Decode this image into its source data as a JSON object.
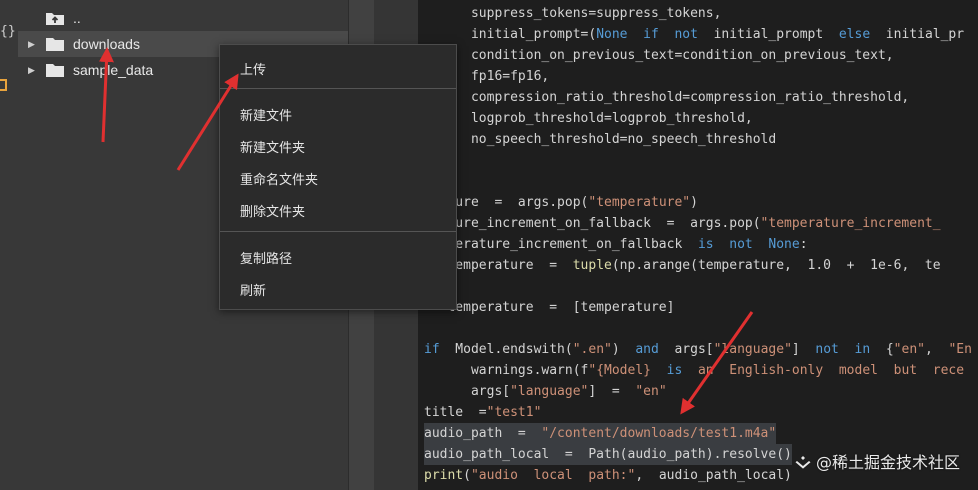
{
  "left_strip": {
    "brace": "{}"
  },
  "file_browser": {
    "items": [
      {
        "label": "..",
        "type": "parent"
      },
      {
        "label": "downloads",
        "type": "folder"
      },
      {
        "label": "sample_data",
        "type": "folder"
      }
    ]
  },
  "context_menu": {
    "items": [
      "上传",
      "新建文件",
      "新建文件夹",
      "重命名文件夹",
      "删除文件夹",
      "复制路径",
      "刷新"
    ]
  },
  "code_lines": [
    "      suppress_tokens=suppress_tokens,",
    "      initial_prompt=(None  if  not  initial_prompt  else  initial_pr",
    "      condition_on_previous_text=condition_on_previous_text,",
    "      fp16=fp16,",
    "      compression_ratio_threshold=compression_ratio_threshold,",
    "      logprob_threshold=logprob_threshold,",
    "      no_speech_threshold=no_speech_threshold",
    "",
    "",
    "erature  =  args.pop(\"temperature\")",
    "erature_increment_on_fallback  =  args.pop(\"temperature_increment_",
    "temperature_increment_on_fallback  is  not  None:",
    "   temperature  =  tuple(np.arange(temperature,  1.0  +  1e-6,  te",
    ":",
    "   temperature  =  [temperature]",
    "",
    "if  Model.endswith(\".en\")  and  args[\"language\"]  not  in  {\"en\",  \"En",
    "      warnings.warn(f\"{Model}  is  an  English-only  model  but  rece",
    "      args[\"language\"]  =  \"en\"",
    "title  =\"test1\"",
    "audio_path  =  \"/content/downloads/test1.m4a\"",
    "audio_path_local  =  Path(audio_path).resolve()",
    "print(\"audio  local  path:\",  audio_path_local)"
  ],
  "watermark": "@稀土掘金技术社区",
  "colors": {
    "accent_arrow": "#e03030",
    "keyword": "#569cd6",
    "string": "#ce9178"
  }
}
